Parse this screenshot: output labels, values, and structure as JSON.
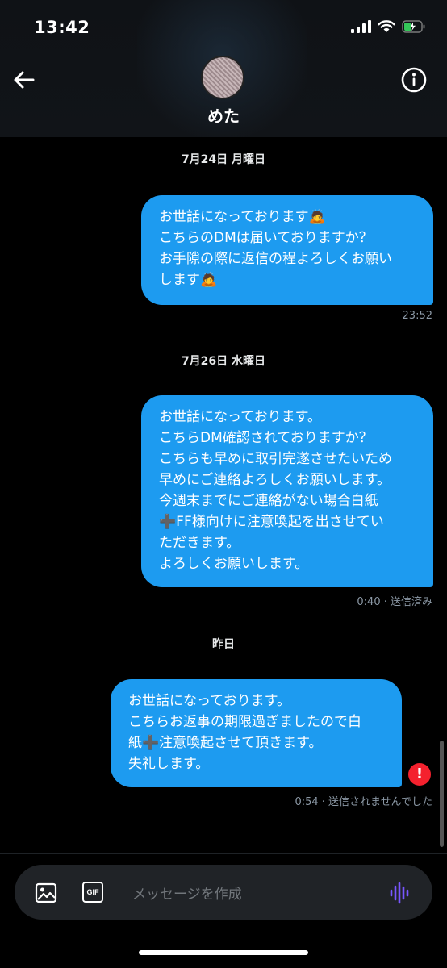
{
  "status_bar": {
    "time": "13:42"
  },
  "header": {
    "contact_name": "めた"
  },
  "messages": [
    {
      "date": "7月24日 月曜日",
      "text": "お世話になっております🙇\nこちらのDMは届いておりますか？\nお手隙の際に返信の程よろしくお願い\nします🙇",
      "time": "23:52"
    },
    {
      "date": "7月26日 水曜日",
      "text": "お世話になっております。\nこちらDM確認されておりますか？\nこちらも早めに取引完遂させたいため\n早めにご連絡よろしくお願いします。\n今週末までにご連絡がない場合白紙\n➕FF様向けに注意喚起を出させてい\nただきます。\nよろしくお願いします。",
      "time": "0:40 · 送信済み"
    },
    {
      "date": "昨日",
      "text": "お世話になっております。\nこちらお返事の期限過ぎましたので白\n紙➕注意喚起させて頂きます。\n失礼します。",
      "time": "0:54 · 送信されませんでした"
    }
  ],
  "composer": {
    "placeholder": "メッセージを作成",
    "gif_label": "GIF"
  },
  "colors": {
    "bubble": "#1d9bf0",
    "error": "#f4212e",
    "mic_accent": "#7856ff"
  }
}
